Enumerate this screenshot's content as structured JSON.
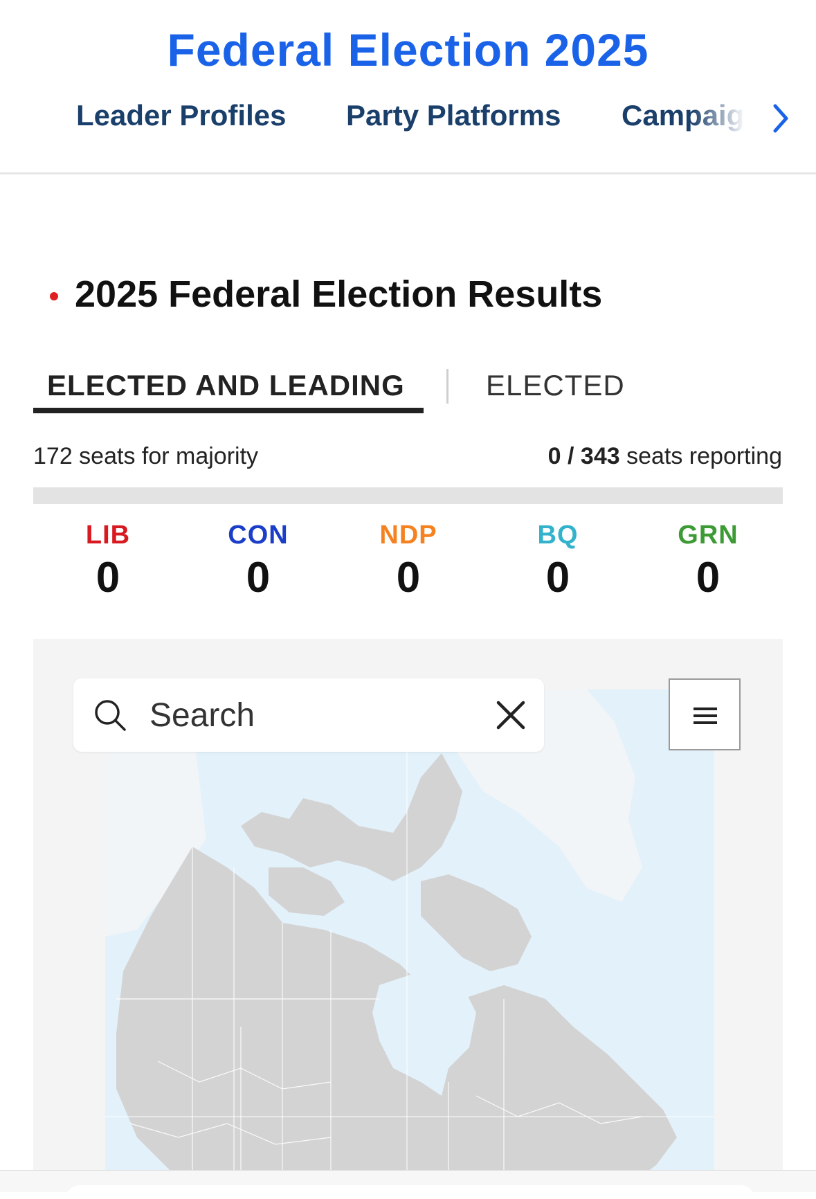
{
  "header": {
    "site_title": "Federal Election 2025",
    "nav": [
      {
        "label": "Leader Profiles"
      },
      {
        "label": "Party Platforms"
      },
      {
        "label": "Campaign"
      }
    ],
    "nav_next_icon": "chevron-right-icon"
  },
  "results": {
    "title": "2025 Federal Election Results",
    "tabs": [
      {
        "label": "ELECTED AND LEADING",
        "active": true
      },
      {
        "label": "ELECTED",
        "active": false
      }
    ],
    "majority_text": "172 seats for majority",
    "reporting": {
      "count": "0 / 343",
      "suffix": " seats reporting"
    },
    "progress_fraction": 0,
    "parties": [
      {
        "abbr": "LIB",
        "seats": "0",
        "color": "#d71920"
      },
      {
        "abbr": "CON",
        "seats": "0",
        "color": "#1a3ec8"
      },
      {
        "abbr": "NDP",
        "seats": "0",
        "color": "#f58220"
      },
      {
        "abbr": "BQ",
        "seats": "0",
        "color": "#33b2cc"
      },
      {
        "abbr": "GRN",
        "seats": "0",
        "color": "#3d9b35"
      }
    ]
  },
  "map": {
    "search": {
      "placeholder": "Search",
      "search_icon": "search-icon",
      "clear_icon": "close-icon"
    },
    "menu_icon": "hamburger-icon",
    "land_color": "#d3d3d3",
    "water_color": "#e3f1fa"
  }
}
